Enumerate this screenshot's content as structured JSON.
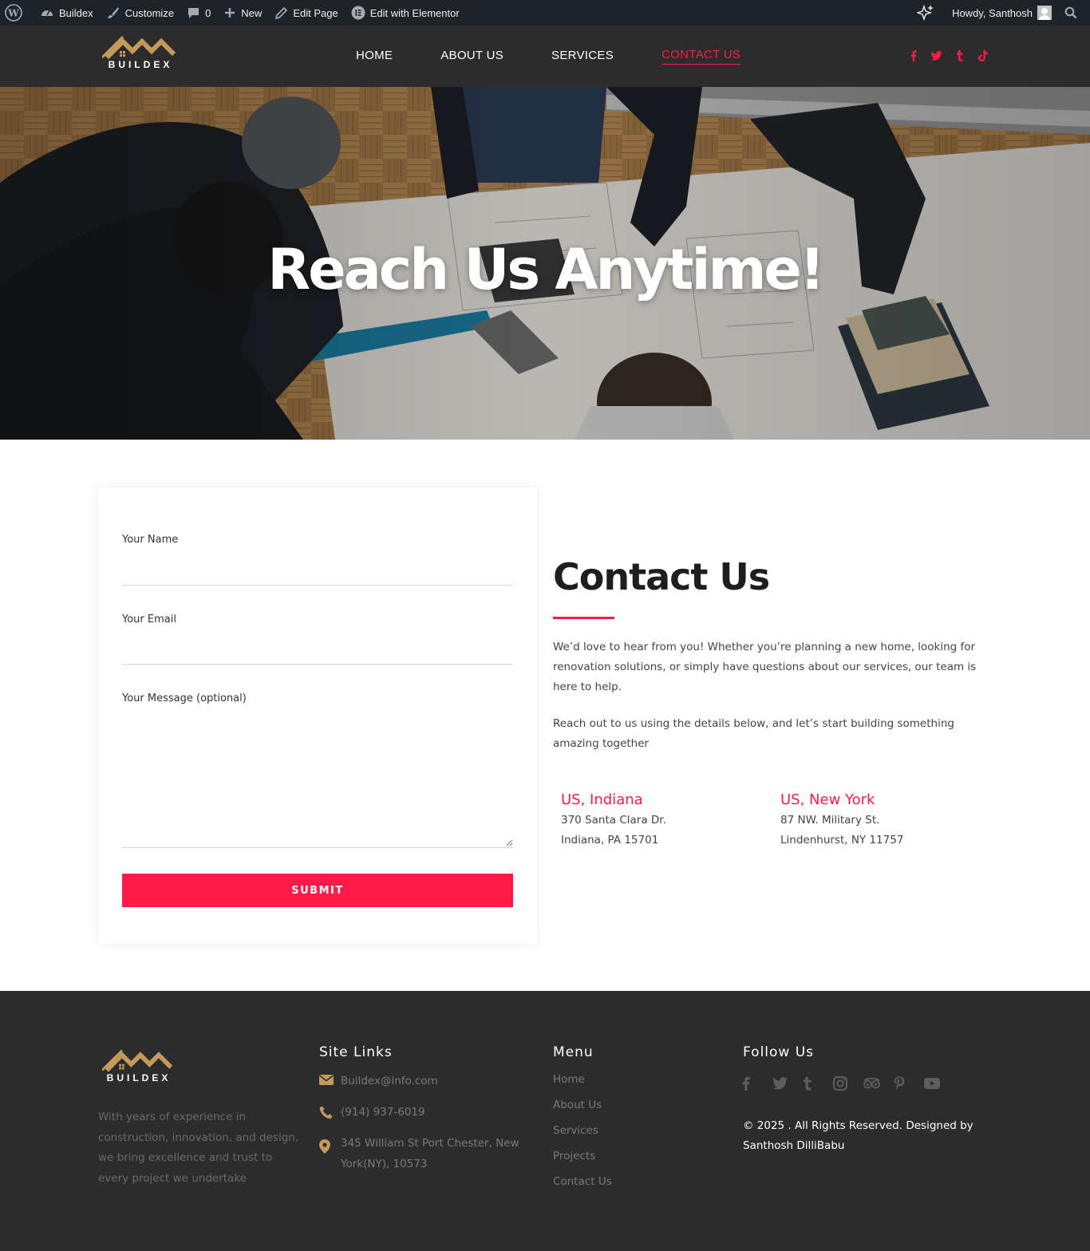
{
  "adminbar": {
    "site_name": "Buildex",
    "customize": "Customize",
    "comments_count": "0",
    "new": "New",
    "edit_page": "Edit Page",
    "edit_elementor": "Edit with Elementor",
    "howdy": "Howdy, Santhosh"
  },
  "header": {
    "logo_text": "BUILDEX",
    "nav": [
      "HOME",
      "ABOUT US",
      "SERVICES",
      "CONTACT US"
    ],
    "active_nav": "CONTACT US",
    "social_icons": [
      "facebook-icon",
      "twitter-icon",
      "tumblr-icon",
      "tiktok-icon"
    ],
    "accent_color": "#ff1a47"
  },
  "hero": {
    "title": "Reach Us Anytime!"
  },
  "form": {
    "name_label": "Your Name",
    "email_label": "Your Email",
    "message_label": "Your Message (optional)",
    "submit_label": "SUBMIT"
  },
  "contact": {
    "title": "Contact Us",
    "para1": "We’d love to hear from you! Whether you’re planning a new home, looking for renovation solutions, or simply have questions about our services, our team is here to help.",
    "para2": "Reach out to us using the details below, and let’s start building something amazing together",
    "offices": [
      {
        "title": "US, Indiana",
        "line1": "370 Santa Clara Dr.",
        "line2": "Indiana, PA 15701"
      },
      {
        "title": "US, New York",
        "line1": "87 NW. Military St.",
        "line2": "Lindenhurst, NY 11757"
      }
    ]
  },
  "footer": {
    "logo_text": "BUILDEX",
    "about": "With years of experience in construction, innovation, and design, we bring excellence and trust to every project we undertake",
    "site_links_heading": "Site Links",
    "email": "Buildex@info.com",
    "phone": "(914) 937-6019",
    "address": "345 William St Port Chester, New York(NY), 10573",
    "menu_heading": "Menu",
    "menu": [
      "Home",
      "About Us",
      "Services",
      "Projects",
      "Contact Us"
    ],
    "follow_heading": "Follow Us",
    "social_icons": [
      "facebook-icon",
      "twitter-icon",
      "tumblr-icon",
      "instagram-icon",
      "tripadvisor-icon",
      "pinterest-icon",
      "youtube-icon"
    ],
    "copyright": "© 2025 . All Rights Reserved. Designed by Santhosh DilliBabu",
    "gold_color": "#c49a5c"
  }
}
